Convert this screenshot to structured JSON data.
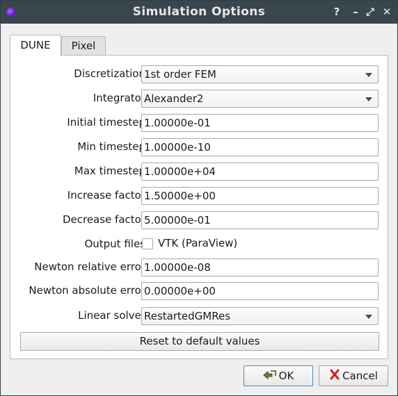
{
  "window": {
    "title": "Simulation Options",
    "help_label": "?",
    "minimize_label": "–",
    "maximize_label": "⤢",
    "close_label": "✕"
  },
  "tabs": [
    {
      "label": "DUNE",
      "active": true
    },
    {
      "label": "Pixel",
      "active": false
    }
  ],
  "form": {
    "discretization": {
      "label": "Discretization",
      "value": "1st order FEM"
    },
    "integrator": {
      "label": "Integrator",
      "value": "Alexander2"
    },
    "initial_timestep": {
      "label": "Initial timestep",
      "value": "1.00000e-01"
    },
    "min_timestep": {
      "label": "Min timestep",
      "value": "1.00000e-10"
    },
    "max_timestep": {
      "label": "Max timestep",
      "value": "1.00000e+04"
    },
    "increase_factor": {
      "label": "Increase factor",
      "value": "1.50000e+00"
    },
    "decrease_factor": {
      "label": "Decrease factor",
      "value": "5.00000e-01"
    },
    "output_files": {
      "label": "Output files",
      "checkbox_label": "VTK (ParaView)",
      "checked": false
    },
    "newton_relative_error": {
      "label": "Newton relative error",
      "value": "1.00000e-08"
    },
    "newton_absolute_error": {
      "label": "Newton absolute error",
      "value": "0.00000e+00"
    },
    "linear_solver": {
      "label": "Linear solver",
      "value": "RestartedGMRes"
    },
    "reset_label": "Reset to default values"
  },
  "buttons": {
    "ok_label": "OK",
    "cancel_label": "Cancel"
  },
  "colors": {
    "titlebar": "#3a464d",
    "app_icon": "#6a1fd6",
    "ok_border": "#4a86c8",
    "cancel_x": "#d0211a"
  }
}
